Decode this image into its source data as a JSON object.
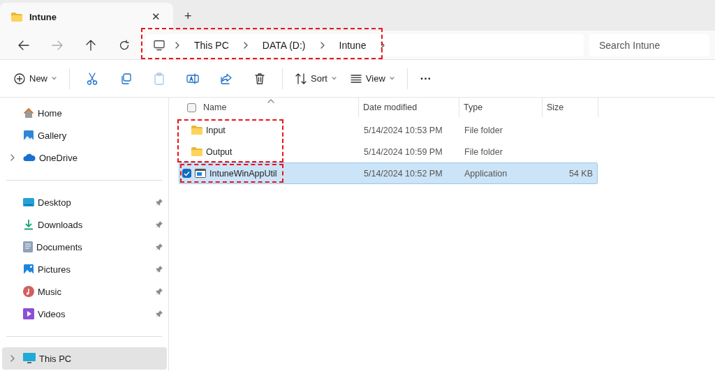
{
  "tab": {
    "title": "Intune",
    "close": "✕",
    "new_tab": "+"
  },
  "breadcrumb": {
    "highlighted": true,
    "parts": [
      "This PC",
      "DATA (D:)",
      "Intune"
    ]
  },
  "search": {
    "placeholder": "Search Intune"
  },
  "toolbar": {
    "new": "New",
    "sort": "Sort",
    "view": "View",
    "more": "···"
  },
  "sidebar": {
    "groups": [
      [
        {
          "label": "Home",
          "expandable": false,
          "pinned": false,
          "selected": false
        },
        {
          "label": "Gallery",
          "expandable": false,
          "pinned": false,
          "selected": false
        },
        {
          "label": "OneDrive",
          "expandable": true,
          "pinned": false,
          "selected": false
        }
      ],
      [
        {
          "label": "Desktop",
          "expandable": false,
          "pinned": true,
          "selected": false
        },
        {
          "label": "Downloads",
          "expandable": false,
          "pinned": true,
          "selected": false
        },
        {
          "label": "Documents",
          "expandable": false,
          "pinned": true,
          "selected": false
        },
        {
          "label": "Pictures",
          "expandable": false,
          "pinned": true,
          "selected": false
        },
        {
          "label": "Music",
          "expandable": false,
          "pinned": true,
          "selected": false
        },
        {
          "label": "Videos",
          "expandable": false,
          "pinned": true,
          "selected": false
        }
      ],
      [
        {
          "label": "This PC",
          "expandable": true,
          "pinned": false,
          "selected": true
        }
      ]
    ]
  },
  "table": {
    "columns": [
      "Name",
      "Date modified",
      "Type",
      "Size"
    ],
    "select_all_checked": false,
    "rows": [
      {
        "name": "Input",
        "kind": "folder",
        "date": "5/14/2024 10:53 PM",
        "type": "File folder",
        "size": "",
        "selected": false,
        "outlined": true,
        "outline_start": true
      },
      {
        "name": "Output",
        "kind": "folder",
        "date": "5/14/2024 10:59 PM",
        "type": "File folder",
        "size": "",
        "selected": false,
        "outlined": true,
        "outline_start": false
      },
      {
        "name": "IntuneWinAppUtil",
        "kind": "application",
        "date": "5/14/2024 10:52 PM",
        "type": "Application",
        "size": "54 KB",
        "selected": true,
        "outlined": true,
        "outline_start": true
      }
    ]
  }
}
